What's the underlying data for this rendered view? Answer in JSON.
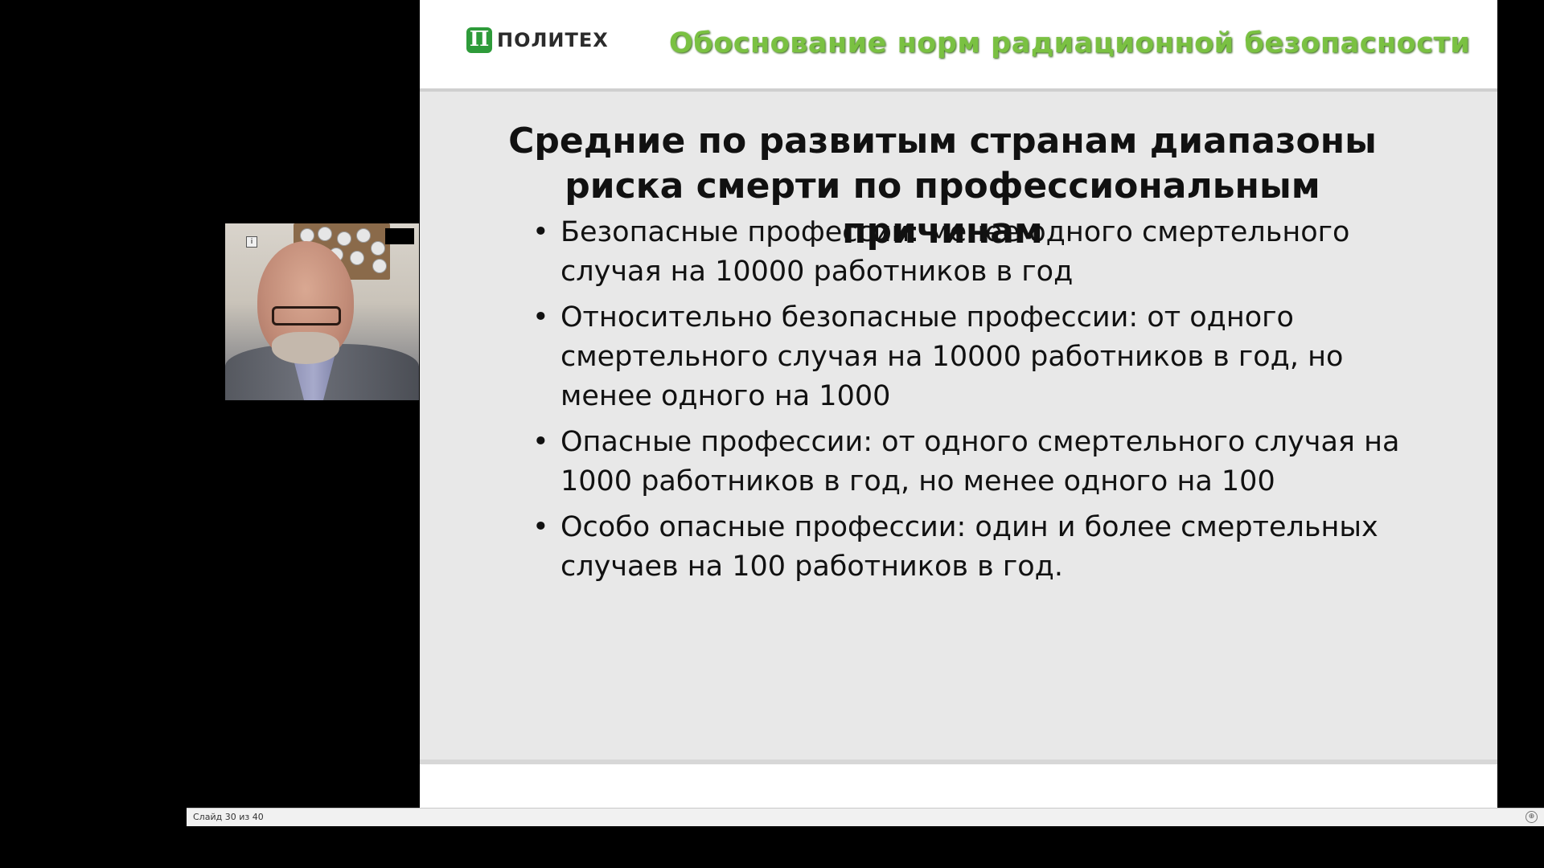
{
  "slide": {
    "logo_text": "ПОЛИТЕХ",
    "logo_mark": "П",
    "header_title": "Обоснование норм радиационной безопасности",
    "title": "Средние по развитым странам диапазоны  риска смерти по профессиональным причинам",
    "bullets": [
      "Безопасные профессии: менее одного смертельного случая на 10000 работников в год",
      "Относительно безопасные профессии: от одного смертельного случая на 10000 работников в год, но менее одного на 1000",
      "Опасные профессии: от одного смертельного случая на 1000 работников в год, но менее одного на 100",
      "Особо опасные профессии: один и более смертельных случаев на 100 работников в год."
    ]
  },
  "statusbar": {
    "slide_counter": "Слайд 30 из 40"
  },
  "colors": {
    "header_title": "#7ac142",
    "logo": "#2e9b3a",
    "slide_bg": "#e8e8e8"
  }
}
